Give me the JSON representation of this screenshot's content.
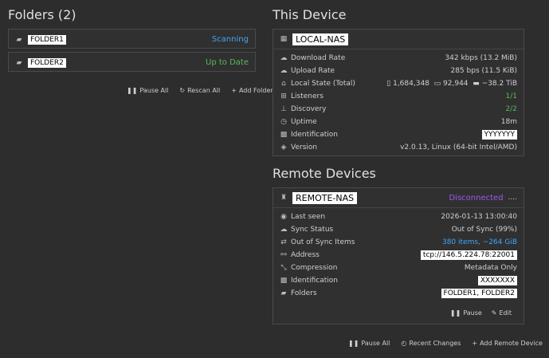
{
  "folders": {
    "title": "Folders (2)",
    "items": [
      {
        "name": "FOLDER1",
        "status": "Scanning"
      },
      {
        "name": "FOLDER2",
        "status": "Up to Date"
      }
    ],
    "buttons": {
      "pause_all": "Pause All",
      "rescan_all": "Rescan All",
      "add_folder": "Add Folder"
    }
  },
  "this_device": {
    "title": "This Device",
    "name": "LOCAL-NAS",
    "download_rate_label": "Download Rate",
    "download_rate_value": "342 kbps (13.2 MiB)",
    "upload_rate_label": "Upload Rate",
    "upload_rate_value": "285 bps (11.5 KiB)",
    "local_state_label": "Local State (Total)",
    "local_state_files": "1,684,348",
    "local_state_dirs": "92,944",
    "local_state_size": "~38.2 TiB",
    "listeners_label": "Listeners",
    "listeners_value": "1/1",
    "discovery_label": "Discovery",
    "discovery_value": "2/2",
    "uptime_label": "Uptime",
    "uptime_value": "18m",
    "identification_label": "Identification",
    "identification_value": "YYYYYYY",
    "version_label": "Version",
    "version_value": "v2.0.13, Linux (64-bit Intel/AMD)"
  },
  "remote": {
    "title": "Remote Devices",
    "name": "REMOTE-NAS",
    "status": "Disconnected",
    "status_suffix": "....",
    "last_seen_label": "Last seen",
    "last_seen_value": "2026-01-13 13:00:40",
    "sync_status_label": "Sync Status",
    "sync_status_value": "Out of Sync (99%)",
    "out_of_sync_label": "Out of Sync Items",
    "out_of_sync_value": "380 items, ~264 GiB",
    "address_label": "Address",
    "address_value": "tcp://146.5.224.78:22001",
    "compression_label": "Compression",
    "compression_value": "Metadata Only",
    "identification_label": "Identification",
    "identification_value": "XXXXXXX",
    "folders_label": "Folders",
    "folders_value": "FOLDER1, FOLDER2",
    "pause_label": "Pause",
    "edit_label": "Edit"
  },
  "bottom_buttons": {
    "pause_all": "Pause All",
    "recent_changes": "Recent Changes",
    "add_remote": "Add Remote Device"
  }
}
